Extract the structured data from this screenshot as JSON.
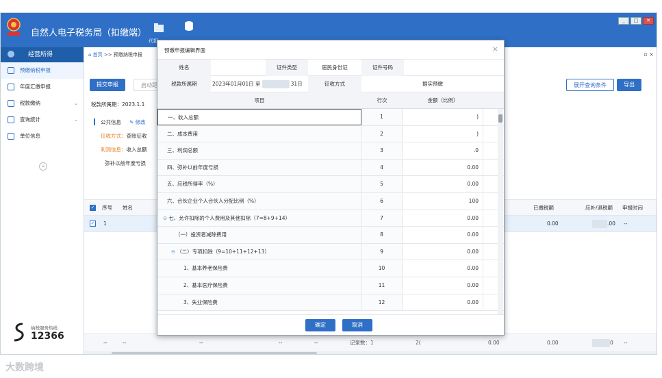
{
  "app": {
    "title": "自然人电子税务局（扣缴端）",
    "nav": [
      {
        "label": "代扣",
        "icon": "folder-icon"
      },
      {
        "label": "",
        "icon": "coins-icon"
      }
    ],
    "window_buttons": {
      "minimize": "_",
      "maximize": "□",
      "close": "✕"
    }
  },
  "sidebar": {
    "header": "经营所得",
    "items": [
      {
        "label": "预缴纳税申报",
        "icon": "document-icon",
        "active": true,
        "expandable": false
      },
      {
        "label": "年度汇缴申报",
        "icon": "calendar-icon",
        "active": false,
        "expandable": false
      },
      {
        "label": "税款缴纳",
        "icon": "tax-icon",
        "active": false,
        "expandable": true
      },
      {
        "label": "查询统计",
        "icon": "chart-icon",
        "active": false,
        "expandable": true
      },
      {
        "label": "单位信息",
        "icon": "building-icon",
        "active": false,
        "expandable": false
      }
    ],
    "collapse": "«",
    "hotline": {
      "label": "纳税服务热线",
      "number": "12366"
    }
  },
  "main": {
    "breadcrumb_home": "首页",
    "breadcrumb_sep": ">>",
    "breadcrumb_page": "预缴纳税申报",
    "tab_controls": "▫ ×",
    "buttons": {
      "submit": "提交申报",
      "auto": "启动距",
      "expand_query": "展开查询条件",
      "export": "导出"
    },
    "period_label": "税款所属期：2023.1.1",
    "public_info": "公共信息",
    "edit": "修改",
    "collect_method_label": "征收方式：",
    "collect_method_value": "查账征收",
    "profit_info_label": "利润信息：",
    "profit_info_value": "收入总额",
    "loss_label": "弥补以前年度亏损",
    "grid": {
      "headers": [
        "序号",
        "姓名",
        "已缴税额",
        "应补/退税额",
        "申报时间"
      ],
      "row": {
        "index": "1",
        "paid": "0.00",
        "due": ".00",
        "time": "--"
      },
      "footer": {
        "d1": "--",
        "d2": "--",
        "d3": "--",
        "d4": "--",
        "d5": "--",
        "record_count": "记录数：1",
        "a": "2(",
        "b": "0.00",
        "c": "0.00",
        "d": "0",
        "e": "--"
      }
    }
  },
  "modal": {
    "title": "预缴申报编辑界面",
    "close": "×",
    "info": {
      "name_label": "姓名",
      "name_value": "",
      "id_type_label": "证件类型",
      "id_type_value": "居民身份证",
      "id_number_label": "证件号码",
      "id_number_value": "",
      "period_label": "税款所属期",
      "period_value": "2023年01月01日 至",
      "period_end": "31日",
      "collect_label": "征收方式",
      "collect_value": "据实预缴"
    },
    "columns": [
      "项目",
      "行次",
      "金额（比例）"
    ],
    "rows": [
      {
        "item": "一、收入总额",
        "line": "1",
        "amount": ")",
        "indent": 0,
        "toggle": "",
        "selected": true
      },
      {
        "item": "二、成本费用",
        "line": "2",
        "amount": ")",
        "indent": 0,
        "toggle": "",
        "selected": false
      },
      {
        "item": "三、利润总额",
        "line": "3",
        "amount": ".0",
        "indent": 0,
        "toggle": "",
        "selected": false
      },
      {
        "item": "四、弥补以前年度亏损",
        "line": "4",
        "amount": "0.00",
        "indent": 0,
        "toggle": "",
        "selected": false
      },
      {
        "item": "五、应税所得率（%）",
        "line": "5",
        "amount": "0.00",
        "indent": 0,
        "toggle": "",
        "selected": false
      },
      {
        "item": "六、合伙企业个人合伙人分配比例（%）",
        "line": "6",
        "amount": "100",
        "indent": 0,
        "toggle": "",
        "selected": false
      },
      {
        "item": "七、允许扣除的个人费用及其他扣除（7=8+9+14）",
        "line": "7",
        "amount": "0.00",
        "indent": 0,
        "toggle": "⊖",
        "selected": false
      },
      {
        "item": "（一）投资者减除费用",
        "line": "8",
        "amount": "0.00",
        "indent": 1,
        "toggle": "",
        "selected": false
      },
      {
        "item": "（二）专项扣除（9=10+11+12+13）",
        "line": "9",
        "amount": "0.00",
        "indent": 1,
        "toggle": "⊖",
        "selected": false
      },
      {
        "item": "1、基本养老保险费",
        "line": "10",
        "amount": "0.00",
        "indent": 2,
        "toggle": "",
        "selected": false
      },
      {
        "item": "2、基本医疗保险费",
        "line": "11",
        "amount": "0.00",
        "indent": 2,
        "toggle": "",
        "selected": false
      },
      {
        "item": "3、失业保险费",
        "line": "12",
        "amount": "0.00",
        "indent": 2,
        "toggle": "",
        "selected": false
      }
    ],
    "confirm": "确定",
    "cancel": "取消"
  },
  "watermark": "大数跨境",
  "colors": {
    "primary": "#2f70c6",
    "header": "#2f70c6",
    "sidebar_head": "#1f5ea8",
    "orange": "#e67e22"
  }
}
